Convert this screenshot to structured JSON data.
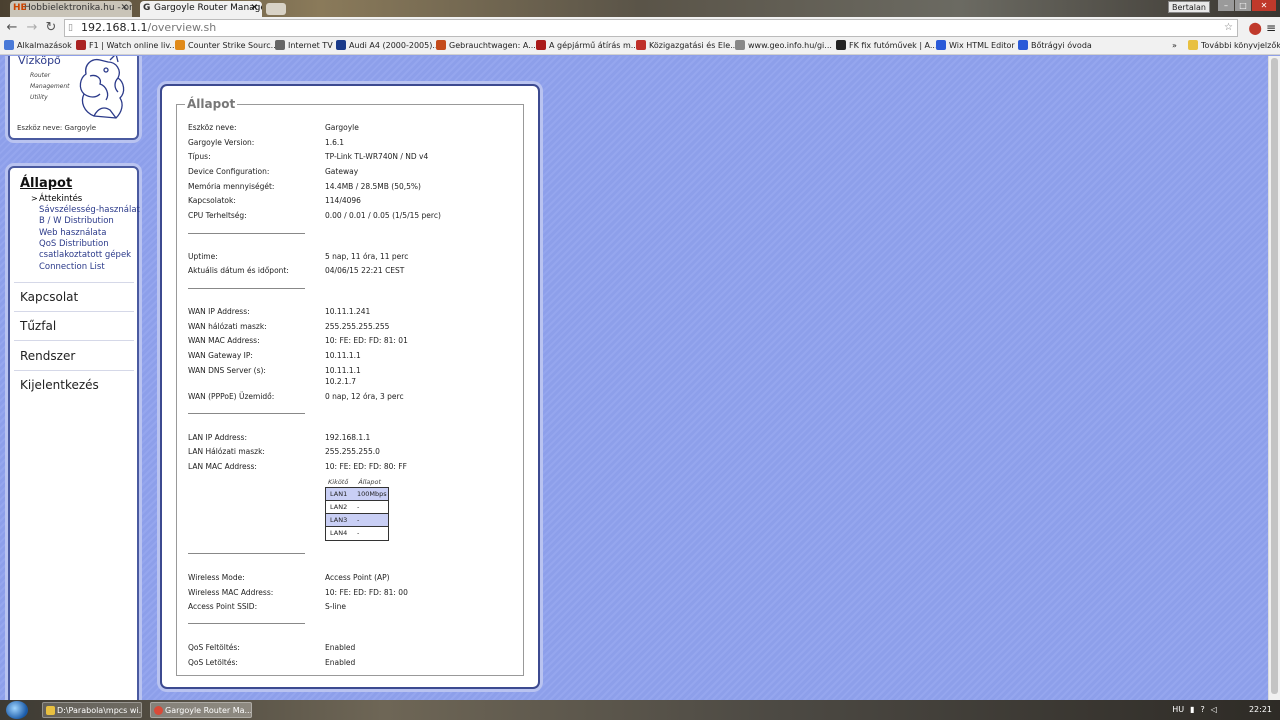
{
  "browser": {
    "tabs": [
      {
        "label": "Hobbielektronika.hu - onl",
        "fav": "HE"
      },
      {
        "label": "Gargoyle Router Managem",
        "fav": "G"
      }
    ],
    "user": "Bertalan",
    "url_host": "192.168.1.1",
    "url_path": "/overview.sh",
    "bookmarks": [
      {
        "label": "Alkalmazások",
        "color": "#4a7ad8"
      },
      {
        "label": "F1 | Watch online liv...",
        "color": "#aa2222"
      },
      {
        "label": "Counter Strike Sourc...",
        "color": "#e08a1a"
      },
      {
        "label": "Internet TV",
        "color": "#666666"
      },
      {
        "label": "Audi A4 (2000-2005)...",
        "color": "#1a3a8a"
      },
      {
        "label": "Gebrauchtwagen: A...",
        "color": "#c44a1a"
      },
      {
        "label": "A gépjármű átírás m...",
        "color": "#aa1a1a"
      },
      {
        "label": "Közigazgatási és Ele...",
        "color": "#c0302a"
      },
      {
        "label": "www.geo.info.hu/gi...",
        "color": "#888888"
      },
      {
        "label": "FK fix futóművek | A...",
        "color": "#222222"
      },
      {
        "label": "Wix HTML Editor",
        "color": "#2a5ad8"
      },
      {
        "label": "Bőtrágyi óvoda",
        "color": "#2a5ad8"
      },
      {
        "label": "»",
        "color": ""
      },
      {
        "label": "További könyvjelzők",
        "color": "#e8c040"
      }
    ]
  },
  "logo": {
    "title": "Vízköpő",
    "sub": [
      "Router",
      "Management",
      "Utility"
    ],
    "device_line": "Eszköz neve: Gargoyle"
  },
  "menu": {
    "active": "Állapot",
    "subitems": [
      "Áttekintés",
      "Sávszélesség-használat",
      "B / W Distribution",
      "Web használata",
      "QoS Distribution",
      "csatlakoztatott gépek",
      "Connection List"
    ],
    "items": [
      "Kapcsolat",
      "Tűzfal",
      "Rendszer",
      "Kijelentkezés"
    ]
  },
  "status": {
    "legend": "Állapot",
    "rows": [
      {
        "label": "Eszköz neve:",
        "value": "Gargoyle"
      },
      {
        "label": "Gargoyle Version:",
        "value": "1.6.1"
      },
      {
        "label": "Típus:",
        "value": "TP-Link TL-WR740N / ND v4"
      },
      {
        "label": "Device Configuration:",
        "value": "Gateway"
      },
      {
        "label": "Memória mennyiségét:",
        "value": "14.4MB / 28.5MB (50,5%)"
      },
      {
        "label": "Kapcsolatok:",
        "value": "114/4096"
      },
      {
        "label": "CPU Terheltség:",
        "value": "0.00 / 0.01 / 0.05   (1/5/15 perc)"
      },
      {
        "label": "Uptime:",
        "value": "5 nap, 11 óra, 11 perc"
      },
      {
        "label": "Aktuális dátum és időpont:",
        "value": "04/06/15 22:21 CEST"
      },
      {
        "label": "WAN IP Address:",
        "value": "10.11.1.241"
      },
      {
        "label": "WAN hálózati maszk:",
        "value": "255.255.255.255"
      },
      {
        "label": "WAN MAC Address:",
        "value": "10: FE: ED: FD: 81: 01"
      },
      {
        "label": "WAN Gateway IP:",
        "value": "10.11.1.1"
      },
      {
        "label": "WAN DNS Server (s):",
        "value": "10.11.1.1"
      },
      {
        "label": "",
        "value": "10.2.1.7"
      },
      {
        "label": "WAN (PPPoE) Üzemidő:",
        "value": "0 nap, 12 óra, 3 perc"
      },
      {
        "label": "LAN IP Address:",
        "value": "192.168.1.1"
      },
      {
        "label": "LAN Hálózati maszk:",
        "value": "255.255.255.0"
      },
      {
        "label": "LAN MAC Address:",
        "value": "10: FE: ED: FD: 80: FF"
      },
      {
        "label": "Wireless Mode:",
        "value": "Access Point (AP)"
      },
      {
        "label": "Wireless MAC Address:",
        "value": "10: FE: ED: FD: 81: 00"
      },
      {
        "label": "Access Point SSID:",
        "value": "S-line"
      },
      {
        "label": "QoS Feltöltés:",
        "value": "Enabled"
      },
      {
        "label": "QoS Letöltés:",
        "value": "Enabled"
      }
    ],
    "lan_ports": {
      "headers": [
        "Kikötő",
        "Állapot"
      ],
      "rows": [
        {
          "port": "LAN1",
          "state": "100Mbps"
        },
        {
          "port": "LAN2",
          "state": "-"
        },
        {
          "port": "LAN3",
          "state": "-"
        },
        {
          "port": "LAN4",
          "state": "-"
        }
      ]
    }
  },
  "taskbar": {
    "tasks": [
      "D:\\Parabola\\mpcs wi...",
      "Gargoyle Router Ma..."
    ],
    "lang": "HU",
    "clock": "22:21"
  }
}
